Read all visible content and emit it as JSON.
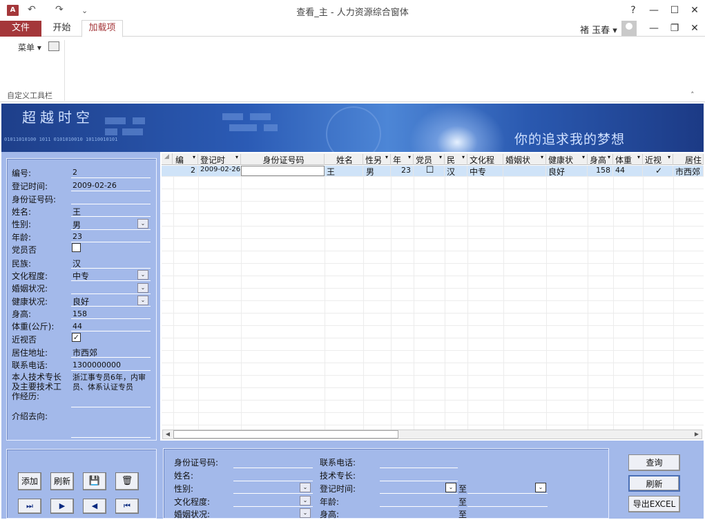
{
  "window": {
    "app_icon": "A",
    "title": "查看_主 - 人力资源综合窗体",
    "help": "?",
    "minimize": "—",
    "maximize": "☐",
    "close": "✕",
    "restore": "❐",
    "inner_minimize": "—",
    "inner_close": "✕"
  },
  "ribbon": {
    "tabs": [
      "文件",
      "开始",
      "加载项"
    ],
    "user": "褚 玉春 ▾",
    "menu_label": "菜单 ▾",
    "group_label": "自定义工具栏",
    "collapse": "˄"
  },
  "banner": {
    "left_text": "超越时空",
    "right_text": "你的追求我的梦想",
    "binary": "01011010100 1011 0101010010 10110010101"
  },
  "detail": {
    "fields": [
      {
        "label": "编号:",
        "value": "2"
      },
      {
        "label": "登记时间:",
        "value": "2009-02-26"
      },
      {
        "label": "身份证号码:",
        "value": ""
      },
      {
        "label": "姓名:",
        "value": "王"
      },
      {
        "label": "性别:",
        "value": "男"
      },
      {
        "label": "年龄:",
        "value": "23"
      },
      {
        "label": "党员否",
        "value": ""
      },
      {
        "label": "民族:",
        "value": "汉"
      },
      {
        "label": "文化程度:",
        "value": "中专"
      },
      {
        "label": "婚姻状况:",
        "value": ""
      },
      {
        "label": "健康状况:",
        "value": "良好"
      },
      {
        "label": "身高:",
        "value": "158"
      },
      {
        "label": "体重(公斤):",
        "value": "44"
      },
      {
        "label": "近视否",
        "value": "✓"
      },
      {
        "label": "居住地址:",
        "value": "市西郊"
      },
      {
        "label": "联系电话:",
        "value": "1300000000"
      },
      {
        "label": "本人技术专长及主要技术工作经历:",
        "value": "浙江事专员6年，内审员、体系认证专员"
      },
      {
        "label": "介绍去向:",
        "value": ""
      }
    ]
  },
  "grid": {
    "columns": [
      "编号",
      "登记时间",
      "身份证号码",
      "姓名",
      "性别",
      "年龄",
      "党员",
      "民族",
      "文化程度",
      "婚姻状况",
      "健康状况",
      "身高",
      "体重",
      "近视",
      "居住"
    ],
    "column_headers_shown": [
      "编 ▾",
      "登记时▾",
      "身份证号码",
      "姓名",
      "性另▾",
      "年 ▾",
      "党员 ▾",
      "民▾",
      "文化程",
      "婚姻状▾",
      "健康状▾",
      "身高▾",
      "体重 ▾",
      "近视 ▾",
      "居住"
    ],
    "row": [
      "2",
      "2009-02-26",
      "",
      "王",
      "男",
      "23",
      "☐",
      "汉",
      "中专",
      "",
      "良好",
      "158",
      "44",
      "✓",
      "市西郊"
    ]
  },
  "buttons": {
    "add": "添加",
    "refresh": "刷新",
    "save_icon": "save-icon",
    "delete_icon": "trash-icon",
    "save_glyph": "💾",
    "delete_glyph": "🗑",
    "nav": [
      "⏭",
      "▶",
      "◀",
      "⏮"
    ]
  },
  "search": {
    "left_labels": [
      "身份证号码:",
      "姓名:",
      "性别:",
      "文化程度:",
      "婚姻状况:"
    ],
    "right_labels": [
      "联系电话:",
      "技术专长:",
      "登记时间:",
      "年龄:",
      "身高:"
    ],
    "to": "至",
    "dropdown_glyph": "⌄",
    "query_btn": "查询",
    "refresh_btn": "刷新",
    "export_btn": "导出EXCEL"
  }
}
